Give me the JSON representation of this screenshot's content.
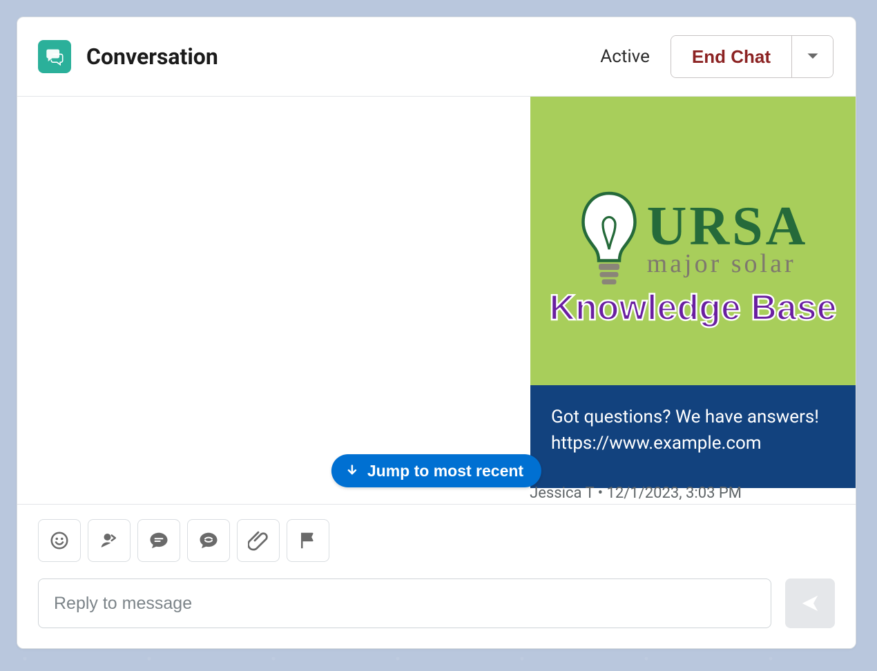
{
  "header": {
    "title": "Conversation",
    "status": "Active",
    "end_chat_label": "End Chat"
  },
  "card": {
    "brand_main": "URSA",
    "brand_sub": "major solar",
    "kb_title": "Knowledge Base",
    "question_line": "Got questions? We have answers!",
    "link_text": "https://www.example.com"
  },
  "message_meta": {
    "author": "Jessica T",
    "separator": "•",
    "timestamp": "12/1/2023, 3:03 PM"
  },
  "jump_button": {
    "label": "Jump to most recent"
  },
  "toolbar": {
    "emoji": "emoji-icon",
    "transfer": "transfer-icon",
    "quick_text": "chat-bubble-icon",
    "whisper": "whisper-icon",
    "attach": "paperclip-icon",
    "flag": "flag-icon"
  },
  "compose": {
    "placeholder": "Reply to message"
  }
}
